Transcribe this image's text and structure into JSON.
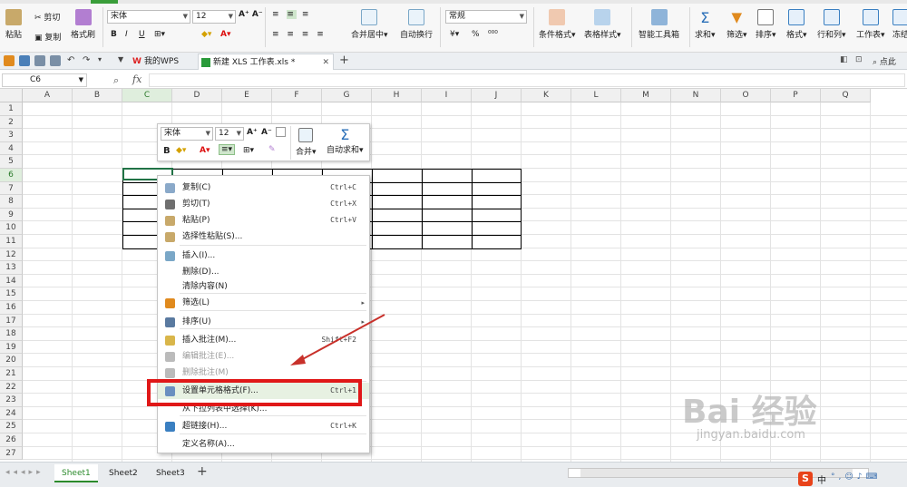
{
  "ribbon": {
    "paste": "粘贴",
    "cut": "剪切",
    "copy": "复制",
    "format_painter": "格式刷",
    "font_name": "宋体",
    "font_size": "12",
    "merge_center": "合并居中",
    "auto_wrap": "自动换行",
    "number_format": "常规",
    "percent": "%",
    "cond_format": "条件格式",
    "table_style": "表格样式",
    "smart_toolbox": "智能工具箱",
    "sum": "求和",
    "filter": "筛选",
    "sort": "排序",
    "format": "格式",
    "row_col": "行和列",
    "worksheet": "工作表",
    "freeze": "冻结"
  },
  "tabs": {
    "my_wps": "我的WPS",
    "doc": "新建 XLS 工作表.xls *",
    "add": "+",
    "search": "点此"
  },
  "formula_bar": {
    "cell_ref": "C6",
    "fx": "fx"
  },
  "grid": {
    "columns": [
      "A",
      "B",
      "C",
      "D",
      "E",
      "F",
      "G",
      "H",
      "I",
      "J",
      "K",
      "L",
      "M",
      "N",
      "O",
      "P",
      "Q"
    ],
    "rows": [
      "1",
      "2",
      "3",
      "4",
      "5",
      "6",
      "7",
      "8",
      "9",
      "10",
      "11",
      "12",
      "13",
      "14",
      "15",
      "16",
      "17",
      "18",
      "19",
      "20",
      "21",
      "22",
      "23",
      "24",
      "25",
      "26",
      "27"
    ],
    "active_column": "C",
    "active_row": "6"
  },
  "mini_toolbar": {
    "font": "宋体",
    "size": "12",
    "bold": "B",
    "merge": "合并",
    "auto_sum": "自动求和",
    "sigma": "Σ"
  },
  "context_menu": {
    "items": [
      {
        "label": "复制(C)",
        "shortcut": "Ctrl+C"
      },
      {
        "label": "剪切(T)",
        "shortcut": "Ctrl+X"
      },
      {
        "label": "粘贴(P)",
        "shortcut": "Ctrl+V"
      },
      {
        "label": "选择性粘贴(S)...",
        "shortcut": ""
      },
      {
        "label": "插入(I)...",
        "shortcut": ""
      },
      {
        "label": "删除(D)...",
        "shortcut": ""
      },
      {
        "label": "清除内容(N)",
        "shortcut": ""
      },
      {
        "label": "筛选(L)",
        "shortcut": ""
      },
      {
        "label": "排序(U)",
        "shortcut": ""
      },
      {
        "label": "插入批注(M)...",
        "shortcut": "Shift+F2"
      },
      {
        "label": "编辑批注(E)...",
        "shortcut": ""
      },
      {
        "label": "删除批注(M)",
        "shortcut": ""
      },
      {
        "label": "设置单元格格式(F)...",
        "shortcut": "Ctrl+1"
      },
      {
        "label": "从下拉列表中选择(K)...",
        "shortcut": ""
      },
      {
        "label": "超链接(H)...",
        "shortcut": "Ctrl+K"
      },
      {
        "label": "定义名称(A)...",
        "shortcut": ""
      }
    ]
  },
  "sheets": [
    "Sheet1",
    "Sheet2",
    "Sheet3"
  ],
  "add_sheet": "+",
  "watermark": {
    "brand": "Bai 经验",
    "url": "jingyan.baidu.com"
  },
  "status": {
    "ime": "中"
  },
  "colors": {
    "accent_green": "#217346",
    "highlight_red": "#e01818"
  }
}
